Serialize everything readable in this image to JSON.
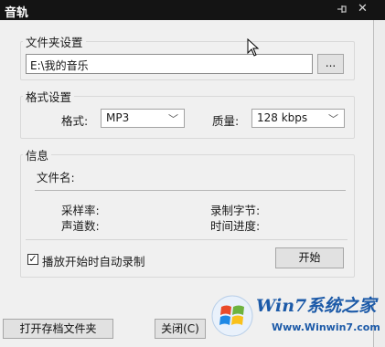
{
  "window": {
    "title": "音轨",
    "pin_icon": "pin-icon",
    "close_icon": "close-icon"
  },
  "folder_group": {
    "legend": "文件夹设置",
    "path_value": "E:\\我的音乐",
    "browse_label": "..."
  },
  "format_group": {
    "legend": "格式设置",
    "format_label": "格式:",
    "format_value": "MP3",
    "quality_label": "质量:",
    "quality_value": "128 kbps"
  },
  "info_group": {
    "legend": "信息",
    "filename_label": "文件名:",
    "sample_rate_label": "采样率:",
    "recorded_bytes_label": "录制字节:",
    "channels_label": "声道数:",
    "time_progress_label": "时间进度:",
    "autorecord_checked": true,
    "autorecord_label": "播放开始时自动录制",
    "start_label": "开始"
  },
  "footer": {
    "open_folder_label": "打开存档文件夹",
    "close_label": "关闭(C)"
  },
  "watermark": {
    "text": "Win7系统之家",
    "url": "Www.Winwin7.com"
  }
}
